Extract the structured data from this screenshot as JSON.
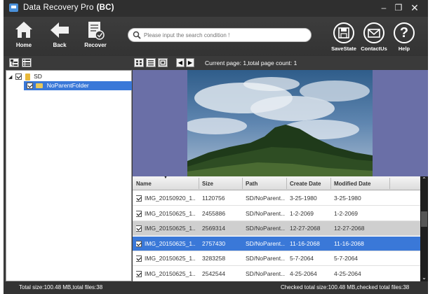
{
  "window": {
    "title": "Data Recovery Pro",
    "edition": "(BC)"
  },
  "toolbar": {
    "home_label": "Home",
    "back_label": "Back",
    "recover_label": "Recover",
    "savestate_label": "SaveState",
    "contactus_label": "ContactUs",
    "help_label": "Help"
  },
  "search": {
    "placeholder": "Please input the search condition !"
  },
  "pager": {
    "info": "Current page: 1,total page count: 1"
  },
  "tree": {
    "root": {
      "label": "SD",
      "checked": true
    },
    "child": {
      "label": "NoParentFolder",
      "checked": true,
      "selected": true
    }
  },
  "table": {
    "columns": [
      "Name",
      "Size",
      "Path",
      "Create Date",
      "Modified Date"
    ],
    "rows": [
      {
        "name": "IMG_20150920_1...",
        "size": "1120756",
        "path": "SD/NoParent...",
        "created": "3-25-1980",
        "modified": "3-25-1980",
        "state": "normal"
      },
      {
        "name": "IMG_20150625_1...",
        "size": "2455886",
        "path": "SD/NoParent...",
        "created": "1-2-2069",
        "modified": "1-2-2069",
        "state": "normal"
      },
      {
        "name": "IMG_20150625_1...",
        "size": "2569314",
        "path": "SD/NoParent...",
        "created": "12-27-2068",
        "modified": "12-27-2068",
        "state": "gray"
      },
      {
        "name": "IMG_20150625_1...",
        "size": "2757430",
        "path": "SD/NoParent...",
        "created": "11-16-2068",
        "modified": "11-16-2068",
        "state": "selected"
      },
      {
        "name": "IMG_20150625_1...",
        "size": "3283258",
        "path": "SD/NoParent...",
        "created": "5-7-2064",
        "modified": "5-7-2064",
        "state": "normal"
      },
      {
        "name": "IMG_20150625_1...",
        "size": "2542544",
        "path": "SD/NoParent...",
        "created": "4-25-2064",
        "modified": "4-25-2064",
        "state": "normal"
      }
    ]
  },
  "status": {
    "left": "Total size:100.48 MB,total files:38",
    "right": "Checked total size:100.48 MB,checked total files:38"
  },
  "colors": {
    "selection": "#3a78d8",
    "preview_bg": "#6a6fa7",
    "chrome": "#3a3a3a"
  }
}
